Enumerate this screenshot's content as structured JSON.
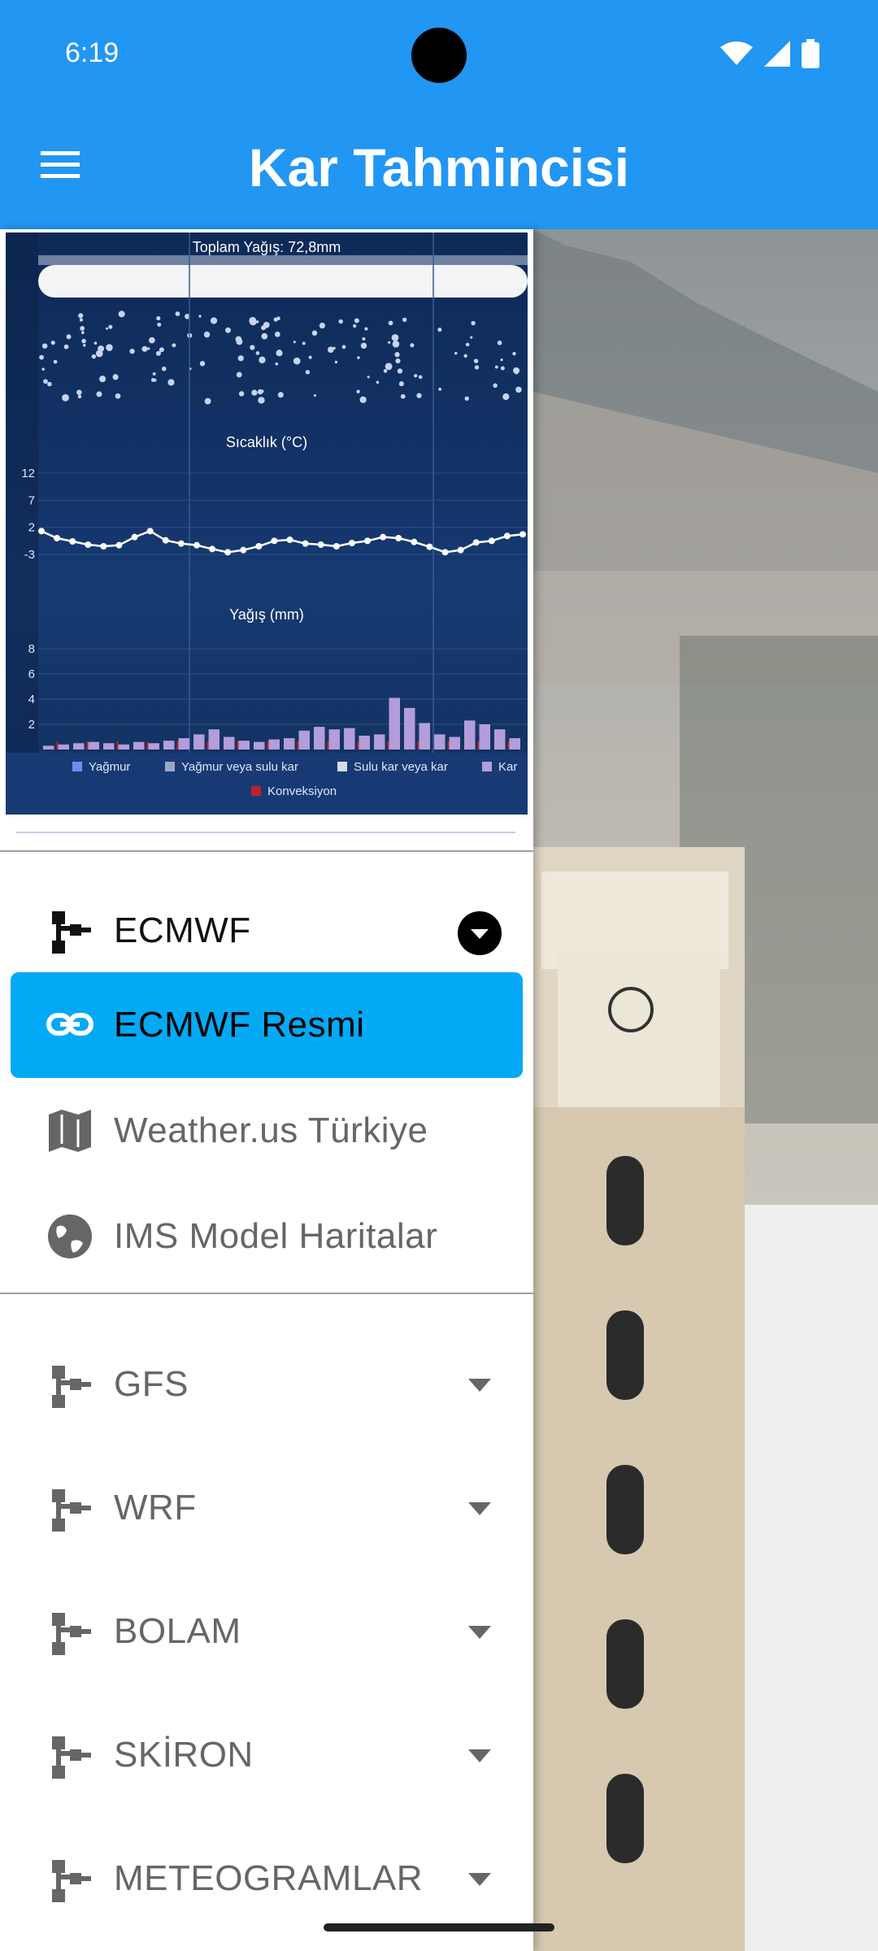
{
  "status_bar": {
    "time": "6:19"
  },
  "app_bar": {
    "title": "Kar Tahmincisi"
  },
  "chart_data": [
    {
      "type": "area",
      "title": "Toplam Yağış: 72,8mm"
    },
    {
      "type": "line",
      "title": "Sıcaklık (°C)",
      "y_ticks": [
        "12",
        "7",
        "2",
        "-3"
      ],
      "ylim": [
        -3,
        12
      ],
      "values": [
        1.3,
        0,
        -0.6,
        -1.2,
        -1.5,
        -1.3,
        0.2,
        1.3,
        -0.4,
        -1.0,
        -1.3,
        -2.0,
        -2.6,
        -2.2,
        -1.5,
        -0.5,
        -0.3,
        -1.0,
        -1.2,
        -1.5,
        -0.9,
        -0.5,
        0.2,
        0.0,
        -0.7,
        -1.6,
        -2.6,
        -2.2,
        -0.8,
        -0.5,
        0.4,
        0.7
      ]
    },
    {
      "type": "bar",
      "title": "Yağış (mm)",
      "y_ticks": [
        "8",
        "6",
        "4",
        "2"
      ],
      "ylim": [
        0,
        8
      ],
      "series": [
        {
          "name": "Yağmur",
          "color": "#6a8ef0"
        },
        {
          "name": "Yağmur veya sulu kar",
          "color": "#9aa6c9"
        },
        {
          "name": "Sulu kar veya kar",
          "color": "#d7dbe8"
        },
        {
          "name": "Kar",
          "color": "#b39ddb",
          "values": [
            0.3,
            0.4,
            0.5,
            0.6,
            0.5,
            0.4,
            0.6,
            0.5,
            0.7,
            0.9,
            1.2,
            1.6,
            1.0,
            0.7,
            0.6,
            0.8,
            0.9,
            1.5,
            1.8,
            1.6,
            1.7,
            1.1,
            1.2,
            4.1,
            3.3,
            2.1,
            1.2,
            1.0,
            2.3,
            2.0,
            1.6,
            0.9
          ]
        },
        {
          "name": "Konveksiyon",
          "color": "#c0202a"
        }
      ]
    }
  ],
  "drawer": {
    "ecmwf": {
      "label": "ECMWF"
    },
    "ecmwf_items": [
      {
        "label": "ECMWF Resmi",
        "icon": "link-icon",
        "selected": true
      },
      {
        "label": "Weather.us Türkiye",
        "icon": "map-icon"
      },
      {
        "label": "IMS Model Haritalar",
        "icon": "globe-icon"
      }
    ],
    "groups": [
      {
        "label": "GFS"
      },
      {
        "label": "WRF"
      },
      {
        "label": "BOLAM"
      },
      {
        "label": "SKİRON"
      },
      {
        "label": "METEOGRAMLAR"
      }
    ]
  },
  "colors": {
    "app_bar": "#2196F3",
    "selected_item": "#03A9F4",
    "chart_bg": "#133266"
  }
}
